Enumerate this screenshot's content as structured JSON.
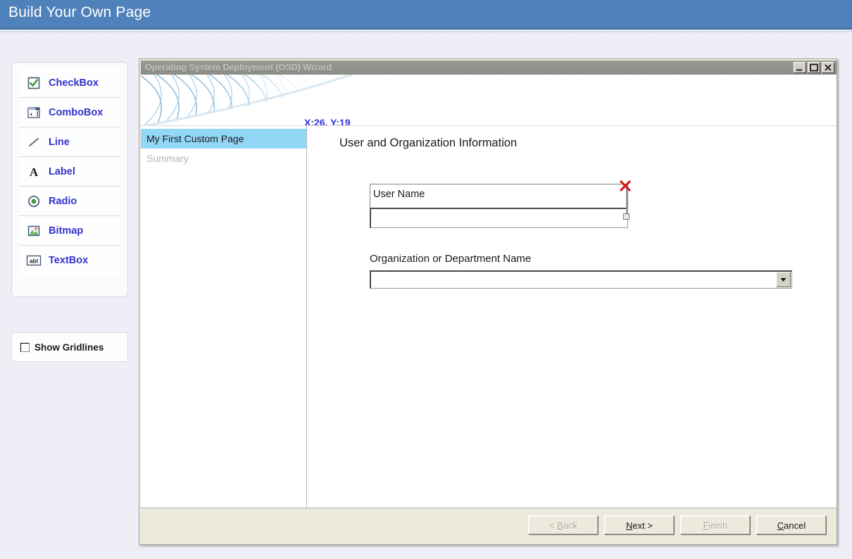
{
  "header": {
    "title": "Build Your Own Page",
    "background": "#4f82bb"
  },
  "toolbox": {
    "items": [
      {
        "label": "CheckBox",
        "icon": "checkbox-icon"
      },
      {
        "label": "ComboBox",
        "icon": "combobox-icon"
      },
      {
        "label": "Line",
        "icon": "line-icon"
      },
      {
        "label": "Label",
        "icon": "label-icon"
      },
      {
        "label": "Radio",
        "icon": "radio-icon"
      },
      {
        "label": "Bitmap",
        "icon": "bitmap-icon"
      },
      {
        "label": "TextBox",
        "icon": "textbox-icon"
      }
    ],
    "label_color": "#3333cc"
  },
  "gridlines": {
    "label": "Show Gridlines",
    "checked": false
  },
  "wizard": {
    "title": "Operating System Deployment (OSD) Wizard",
    "controls": {
      "minimize": "minimize-icon",
      "maximize": "maximize-icon",
      "close": "close-icon"
    },
    "banner": {
      "coords": "X:26, Y:19",
      "coords_color": "#3333dd"
    },
    "nav": {
      "items": [
        {
          "label": "My First Custom Page",
          "active": true
        },
        {
          "label": "Summary",
          "active": false
        }
      ],
      "active_background": "#93d7f7"
    },
    "content": {
      "heading": "User and Organization Information",
      "username_label": "User Name",
      "username_value": "",
      "org_label": "Organization or Department Name",
      "org_value": "",
      "selection_marker": "delete-x-marker"
    },
    "footer": {
      "buttons": [
        {
          "label": "< Back",
          "accel": "B",
          "disabled": true
        },
        {
          "label": "Next >",
          "accel": "N",
          "disabled": false
        },
        {
          "label": "Finish",
          "accel": "F",
          "disabled": true
        },
        {
          "label": "Cancel",
          "accel": "C",
          "disabled": false
        }
      ]
    }
  }
}
